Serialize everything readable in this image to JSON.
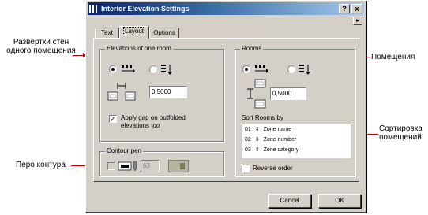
{
  "window": {
    "title": "Interior Elevation Settings",
    "help_button": "?",
    "close_button": "x",
    "scroll_button": "▸"
  },
  "tabs": [
    {
      "label": "Text"
    },
    {
      "label": "Layout"
    },
    {
      "label": "Options"
    }
  ],
  "active_tab": "Layout",
  "elevations_group": {
    "title": "Elevations of one room",
    "gap_value": "0,5000",
    "apply_gap_checked": true,
    "apply_gap_label_line1": "Apply gap on outfolded",
    "apply_gap_label_line2": "elevations too"
  },
  "contour_pen_group": {
    "title": "Contour pen",
    "pen_number": "63",
    "checked": false
  },
  "rooms_group": {
    "title": "Rooms",
    "gap_value": "0,5000",
    "sort_label": "Sort Rooms by",
    "sort_items": [
      {
        "index": "01",
        "name": "Zone name"
      },
      {
        "index": "02",
        "name": "Zone number"
      },
      {
        "index": "03",
        "name": "Zone category"
      }
    ],
    "reverse_order_label": "Reverse order",
    "reverse_order_checked": false
  },
  "buttons": {
    "cancel": "Cancel",
    "ok": "OK"
  },
  "annotations": {
    "elevations_line1": "Развертки стен",
    "elevations_line2": "одного помещения",
    "rooms": "Помещения",
    "sorting_line1": "Сортировка",
    "sorting_line2": "помещений",
    "contour_pen": "Перо контура"
  },
  "colors": {
    "dialog_face": "#d4d0c8",
    "title_bar": "#0a246a",
    "arrow": "#c00000"
  }
}
